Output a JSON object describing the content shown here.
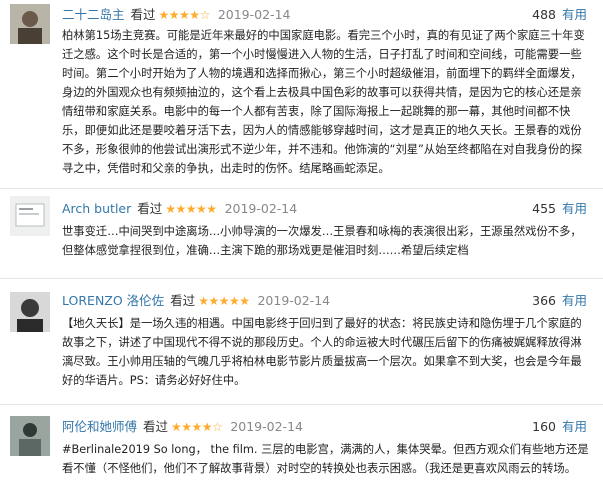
{
  "reviews": [
    {
      "author": "二十二岛主",
      "verb": "看过",
      "stars": "★★★★☆",
      "date": "2019-02-14",
      "useful_count": "488",
      "useful_label": "有用",
      "avatar": "avatar-icon",
      "text": "柏林第15场主竞赛。可能是近年来最好的中国家庭电影。看完三个小时，真的有见证了两个家庭三十年变迁之感。这个时长是合适的，第一个小时慢慢进入人物的生活，日子打乱了时间和空间线，可能需要一些时间。第二个小时开始为了人物的境遇和选择而揪心，第三个小时超级催泪，前面埋下的羁绊全面爆发，身边的外国观众也有频频抽泣的，这个看上去极具中国色彩的故事可以获得共情，是因为它的核心还是亲情纽带和家庭关系。电影中的每一个人都有苦衷，除了国际海报上一起跳舞的那一幕，其他时间都不快乐，即便如此还是要咬着牙活下去，因为人的情感能够穿越时间，这才是真正的地久天长。王景春的戏份不多，形象很帅的他尝试出演形式不逆少年，并不违和。他饰演的“刘星”从始至终都陷在对自我身份的探寻之中，凭借时和父亲的争执，出走时的伤怀。结尾略画蛇添足。"
    },
    {
      "author": "Arch butler",
      "verb": "看过",
      "stars": "★★★★★",
      "date": "2019-02-14",
      "useful_count": "455",
      "useful_label": "有用",
      "avatar": "avatar-icon",
      "text": "世事变迁…中间哭到中途离场…小帅导演的一次爆发…王景春和咏梅的表演很出彩，王源虽然戏份不多，但整体感觉拿捏很到位，准确…主演下跪的那场戏更是催泪时刻……希望后续定档"
    },
    {
      "author": "LORENZO 洛伦佐",
      "verb": "看过",
      "stars": "★★★★★",
      "date": "2019-02-14",
      "useful_count": "366",
      "useful_label": "有用",
      "avatar": "avatar-icon",
      "text": "【地久天长】是一场久违的相遇。中国电影终于回归到了最好的状态：将民族史诗和隐伤埋于几个家庭的故事之下，讲述了中国现代不得不说的那段历史。个人的命运被大时代碾压后留下的伤痛被娓娓释放得淋漓尽致。王小帅用压轴的气魄几乎将柏林电影节影片质量拔高一个层次。如果拿不到大奖，也会是今年最好的华语片。PS：请务必好好住中。"
    },
    {
      "author": "阿伦和她师傅",
      "verb": "看过",
      "stars": "★★★★☆",
      "date": "2019-02-14",
      "useful_count": "160",
      "useful_label": "有用",
      "avatar": "avatar-icon",
      "text": "#Berlinale2019 So long， the film. 三层的电影宫，满满的人，集体哭晕。但西方观众们有些地方还是看不懂（不怪他们，他们不了解故事背景）对时空的转换处也表示困惑。（我还是更喜欢风雨云的转场。"
    }
  ],
  "colors": {
    "link": "#3377aa",
    "star": "#ffac2d",
    "date": "#888888"
  }
}
